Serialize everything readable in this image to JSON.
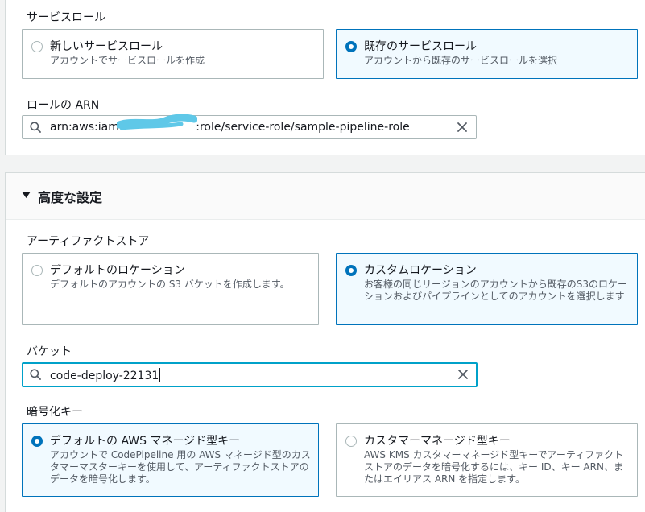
{
  "service_role": {
    "label": "サービスロール",
    "options": [
      {
        "title": "新しいサービスロール",
        "desc": "アカウントでサービスロールを作成",
        "selected": false
      },
      {
        "title": "既存のサービスロール",
        "desc": "アカウントから既存のサービスロールを選択",
        "selected": true
      }
    ]
  },
  "role_arn": {
    "label": "ロールの ARN",
    "value_prefix": "arn:aws:iam::",
    "value_suffix": ":role/service-role/sample-pipeline-role"
  },
  "advanced": {
    "title": "高度な設定",
    "expanded": true
  },
  "artifact_store": {
    "label": "アーティファクトストア",
    "options": [
      {
        "title": "デフォルトのロケーション",
        "desc": "デフォルトのアカウントの S3 バケットを作成します。",
        "selected": false
      },
      {
        "title": "カスタムロケーション",
        "desc": "お客様の同じリージョンのアカウントから既存のS3のロケーションおよびパイプラインとしてのアカウントを選択します",
        "selected": true
      }
    ]
  },
  "bucket": {
    "label": "バケット",
    "value": "code-deploy-22131"
  },
  "encryption_key": {
    "label": "暗号化キー",
    "options": [
      {
        "title": "デフォルトの AWS マネージド型キー",
        "desc": "アカウントで CodePipeline 用の AWS マネージド型のカスタマーマスターキーを使用して、アーティファクトストアのデータを暗号化します。",
        "selected": true
      },
      {
        "title": "カスタマーマネージド型キー",
        "desc": "AWS KMS カスタマーマネージド型キーでアーティファクトストアのデータを暗号化するには、キー ID、キー ARN、またはエイリアス ARN を指定します。",
        "selected": false
      }
    ]
  },
  "colors": {
    "accent": "#0073bb",
    "focus": "#00a1c9",
    "redaction": "#5fc8e8"
  }
}
